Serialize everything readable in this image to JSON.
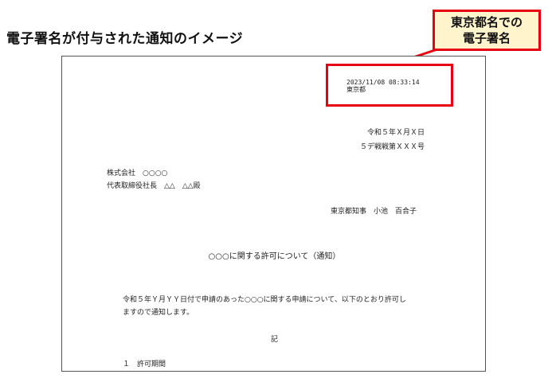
{
  "heading": "電子署名が付与された通知のイメージ",
  "callout": {
    "line1": "東京都名での",
    "line2": "電子署名"
  },
  "signature": {
    "timestamp": "2023/11/08 08:33:14",
    "signer": "東京都"
  },
  "document": {
    "date": "令和５年Ｘ月Ｘ日",
    "doc_number": "５デ戦戦第ＸＸＸ号",
    "recipient_company": "株式会社　○○○○",
    "recipient_person": "代表取締役社長　△△　△△殿",
    "sender": "東京都知事　小池　百合子",
    "title": "○○○に関する許可について（通知）",
    "body_line1": "令和５年Ｙ月ＹＹ日付で申請のあった○○○に関する申請について、以下のとおり許可し",
    "body_line2": "ますので通知します。",
    "ki": "記",
    "item1": "１　許可期間"
  },
  "colors": {
    "accent_red": "#e60012",
    "callout_fill": "#fff4cc"
  }
}
